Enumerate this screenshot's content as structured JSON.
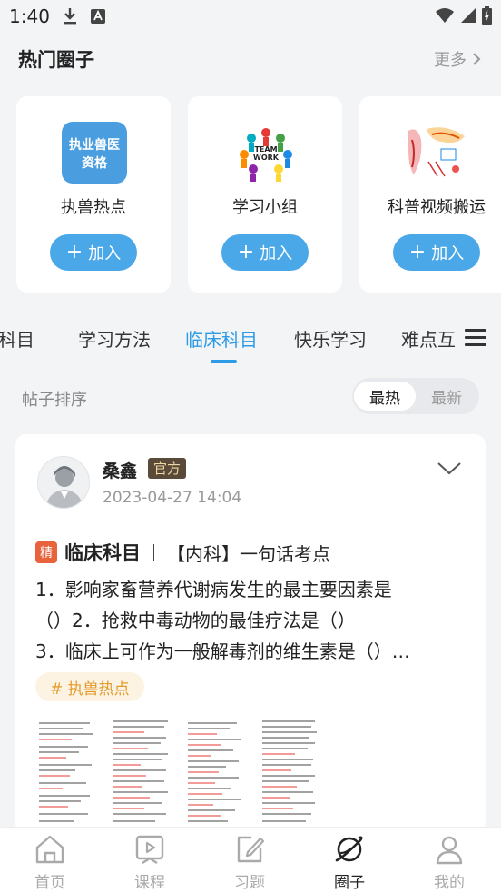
{
  "status_bar": {
    "time": "1:40",
    "icons": [
      "download-icon",
      "app-notification-icon",
      "wifi-icon",
      "signal-icon",
      "battery-charging-icon"
    ]
  },
  "hot_groups": {
    "title": "热门圈子",
    "more_label": "更多",
    "groups": [
      {
        "name": "执兽热点",
        "avatar_text_line1": "执业兽医",
        "avatar_text_line2": "资格",
        "join_label": "加入"
      },
      {
        "name": "学习小组",
        "avatar_text_line1": "TEAM",
        "avatar_text_line2": "WORK",
        "join_label": "加入"
      },
      {
        "name": "科普视频搬运",
        "join_label": "加入"
      }
    ]
  },
  "category_tabs": {
    "items": [
      {
        "label": "药科目",
        "active": false
      },
      {
        "label": "学习方法",
        "active": false
      },
      {
        "label": "临床科目",
        "active": true
      },
      {
        "label": "快乐学习",
        "active": false
      },
      {
        "label": "难点互",
        "active": false
      }
    ],
    "menu_icon": "menu-icon"
  },
  "sort": {
    "label": "帖子排序",
    "options": [
      {
        "label": "最热",
        "active": true
      },
      {
        "label": "最新",
        "active": false
      }
    ]
  },
  "post": {
    "author": "桑鑫",
    "badge": "官方",
    "time": "2023-04-27 14:04",
    "featured_badge": "精",
    "category": "临床科目",
    "subject": "【内科】一句话考点",
    "lines": [
      "1．影响家畜营养代谢病发生的最主要因素是",
      "（）2．抢救中毒动物的最佳疗法是（）",
      "3．临床上可作为一般解毒剂的维生素是（）…"
    ],
    "topic_tag": "# 执兽热点",
    "image_count": 4
  },
  "bottom_nav": {
    "items": [
      {
        "label": "首页",
        "icon": "home-icon",
        "active": false
      },
      {
        "label": "课程",
        "icon": "course-play-icon",
        "active": false
      },
      {
        "label": "习题",
        "icon": "exercise-edit-icon",
        "active": false
      },
      {
        "label": "圈子",
        "icon": "circle-planet-icon",
        "active": true
      },
      {
        "label": "我的",
        "icon": "profile-icon",
        "active": false
      }
    ]
  },
  "colors": {
    "accent": "#2e9be6",
    "join_button": "#4aa8e8",
    "featured": "#e8623c",
    "tag_text": "#e39a2b",
    "background": "#f3f4f6"
  }
}
